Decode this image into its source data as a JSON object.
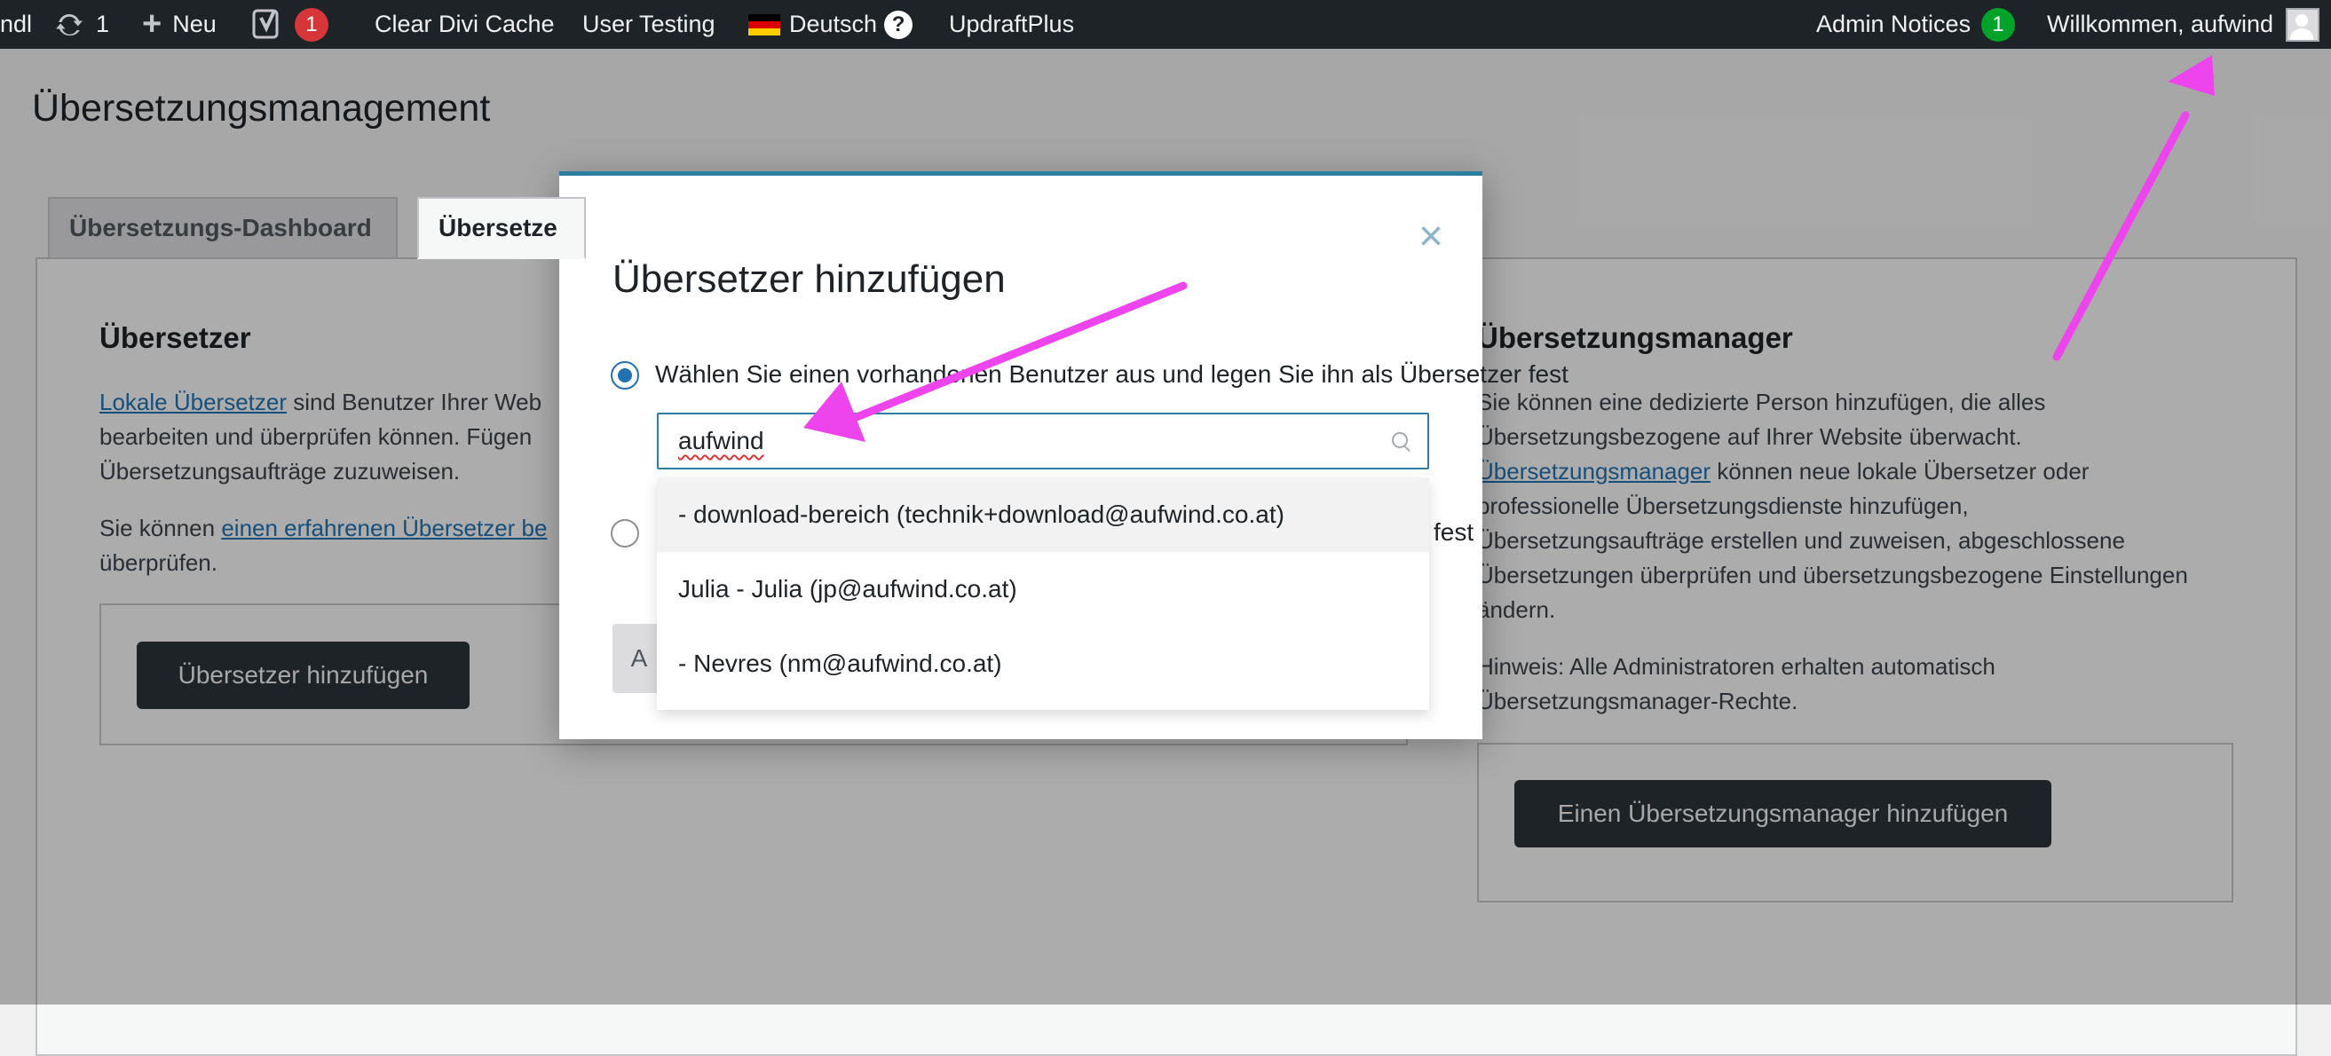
{
  "adminbar": {
    "site_fragment": "ndl",
    "updates_count": "1",
    "new_label": "Neu",
    "yoast_count": "1",
    "clear_cache": "Clear Divi Cache",
    "user_testing": "User Testing",
    "language": "Deutsch",
    "help_symbol": "?",
    "updraft": "UpdraftPlus",
    "admin_notices": "Admin Notices",
    "admin_notices_count": "1",
    "welcome": "Willkommen, aufwind"
  },
  "page": {
    "title": "Übersetzungsmanagement",
    "tabs": [
      {
        "label": "Übersetzungs-Dashboard"
      },
      {
        "label": "Übersetze"
      }
    ]
  },
  "left": {
    "heading": "Übersetzer",
    "p1_link": "Lokale Übersetzer",
    "p1_line1": " sind Benutzer Ihrer Web",
    "p1_line2": "bearbeiten und überprüfen können. Fügen",
    "p1_line3": "Übersetzungsaufträge zuzuweisen.",
    "p2_prefix": "Sie können ",
    "p2_link": "einen erfahrenen Übersetzer be",
    "p2_line2": "überprüfen.",
    "button": "Übersetzer hinzufügen"
  },
  "right": {
    "heading": "Übersetzungsmanager",
    "lines": [
      "Sie können eine dedizierte Person hinzufügen, die alles",
      "Übersetzungsbezogene auf Ihrer Website überwacht."
    ],
    "link": "Übersetzungsmanager",
    "link_rest": " können neue lokale Übersetzer oder",
    "lines2": [
      "professionelle Übersetzungsdienste hinzufügen,",
      "Übersetzungsaufträge erstellen und zuweisen, abgeschlossene",
      "Übersetzungen überprüfen und übersetzungsbezogene Einstellungen",
      "ändern."
    ],
    "note_line1": "Hinweis: Alle Administratoren erhalten automatisch",
    "note_line2": "Übersetzungsmanager-Rechte.",
    "button": "Einen Übersetzungsmanager hinzufügen"
  },
  "modal": {
    "close_symbol": "×",
    "title": "Übersetzer hinzufügen",
    "option1": "Wählen Sie einen vorhandenen Benutzer aus und legen Sie ihn als Übersetzer fest",
    "option2_tail": "fest",
    "search_value": "aufwind",
    "button_stub": "A",
    "results": [
      {
        "label": "- download-bereich (technik+download@aufwind.co.at)"
      },
      {
        "label": "Julia - Julia (jp@aufwind.co.at)"
      },
      {
        "label": "- Nevres (nm@aufwind.co.at)"
      }
    ]
  },
  "colors": {
    "admin_bar": "#1d2327",
    "accent": "#2271b1",
    "annotation": "#ee44ee"
  }
}
